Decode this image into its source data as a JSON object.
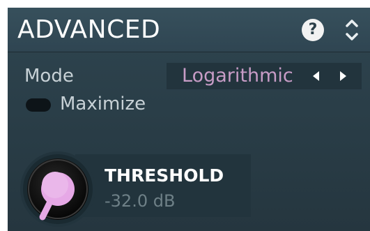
{
  "section": {
    "title": "ADVANCED",
    "help_icon": "question-mark-icon",
    "help_glyph": "?",
    "collapse_icon": "expand-collapse-icon"
  },
  "mode": {
    "label": "Mode",
    "value": "Logarithmic",
    "prev_icon": "arrow-left-icon",
    "next_icon": "arrow-right-icon"
  },
  "maximize": {
    "label": "Maximize",
    "state": "off"
  },
  "threshold": {
    "label": "THRESHOLD",
    "value": "-32.0 dB"
  },
  "colors": {
    "accent": "#e6a8e6",
    "panel": "#2a3e48",
    "text": "#c7d1d6"
  }
}
